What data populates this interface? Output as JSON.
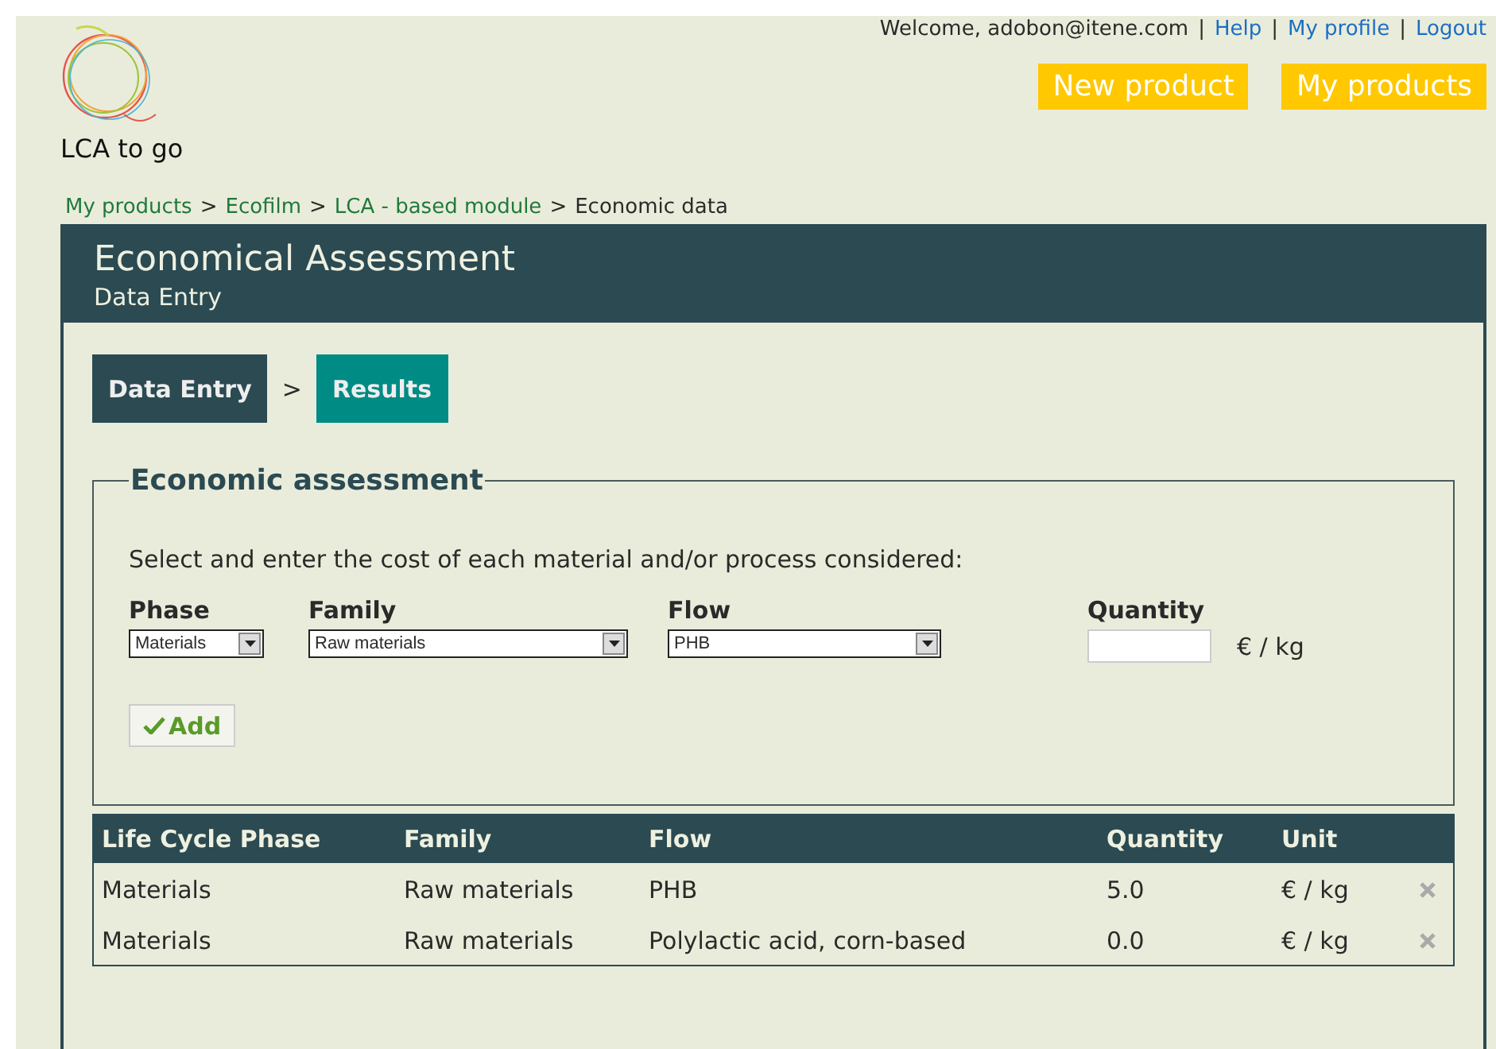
{
  "header": {
    "welcome": "Welcome, adobon@itene.com",
    "links": [
      "Help",
      "My profile",
      "Logout"
    ],
    "link_separator": "|",
    "logo_text": "LCA to go",
    "buttons": [
      "New product",
      "My products"
    ]
  },
  "breadcrumb": {
    "links": [
      "My products",
      "Ecofilm",
      "LCA - based module"
    ],
    "current": "Economic data",
    "separator": ">"
  },
  "panel": {
    "title": "Economical Assessment",
    "subtitle": "Data Entry"
  },
  "steps": [
    {
      "label": "Data Entry",
      "selected": true
    },
    {
      "label": "Results",
      "selected": false
    }
  ],
  "step_separator": ">",
  "form": {
    "legend": "Economic assessment",
    "instruction": "Select and enter the cost of each material and/or process considered:",
    "fields": [
      {
        "kind": "select",
        "label": "Phase",
        "value": "Materials"
      },
      {
        "kind": "select",
        "label": "Family",
        "value": "Raw materials"
      },
      {
        "kind": "select",
        "label": "Flow",
        "value": "PHB"
      },
      {
        "kind": "input",
        "label": "Quantity",
        "unit": "€ / kg"
      }
    ],
    "add_button": "Add"
  },
  "table": {
    "columns": [
      "Life Cycle Phase",
      "Family",
      "Flow",
      "Quantity",
      "Unit"
    ],
    "rows": [
      [
        "Materials",
        "Raw materials",
        "PHB",
        "5.0",
        "€ / kg"
      ],
      [
        "Materials",
        "Raw materials",
        "Polylactic acid, corn-based",
        "0.0",
        "€ / kg"
      ]
    ]
  }
}
